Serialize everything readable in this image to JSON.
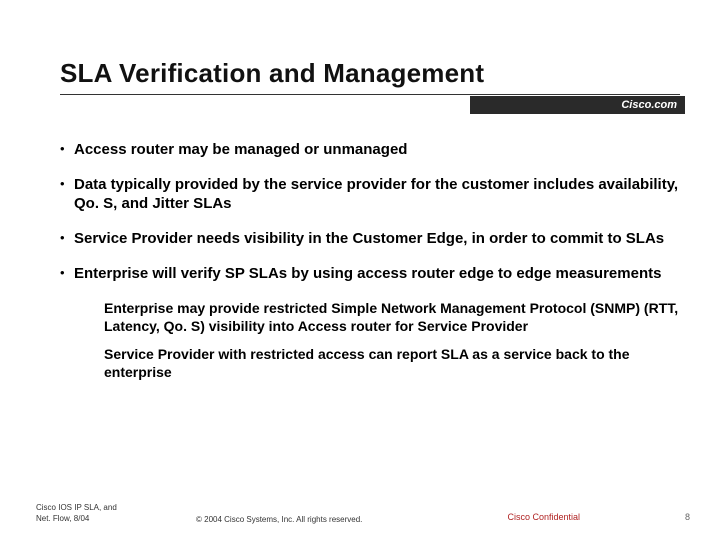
{
  "title": "SLA Verification and Management",
  "brand": "Cisco.com",
  "bullets": [
    "Access router may be managed or unmanaged",
    "Data typically provided by the service provider for the customer includes availability, Qo. S, and Jitter SLAs",
    "Service Provider needs visibility in the Customer Edge, in order to commit to SLAs",
    "Enterprise will verify SP SLAs by using access router edge to edge measurements"
  ],
  "subpoints": [
    "Enterprise may provide restricted Simple Network Management Protocol (SNMP) (RTT, Latency, Qo. S) visibility into Access router for Service Provider",
    "Service Provider with restricted access can report SLA as a service back to the enterprise"
  ],
  "footer": {
    "left_line1": "Cisco IOS IP SLA, and",
    "left_line2": "Net. Flow, 8/04",
    "copyright": "© 2004 Cisco Systems, Inc. All rights reserved.",
    "confidential": "Cisco Confidential",
    "page": "8"
  }
}
